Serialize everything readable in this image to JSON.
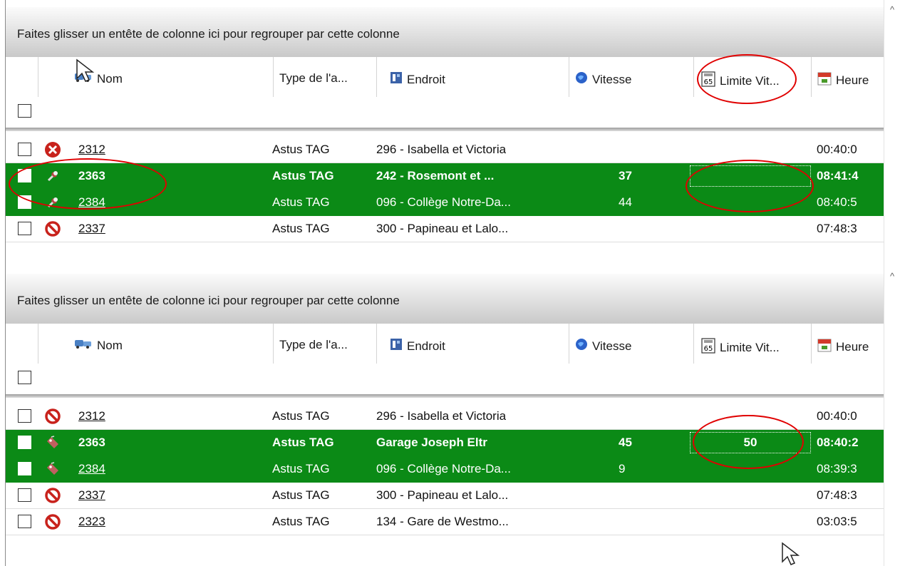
{
  "colors": {
    "selected_row_bg": "#0b8a16",
    "annotation": "#e00000"
  },
  "panels": [
    {
      "group_hint": "Faites glisser un entête de colonne ici pour regrouper par cette colonne",
      "columns": [
        {
          "label": "Nom",
          "icon": "bus-icon"
        },
        {
          "label": "Type de l'a...",
          "icon": ""
        },
        {
          "label": "Endroit",
          "icon": "building-icon"
        },
        {
          "label": "Vitesse",
          "icon": "globe-icon"
        },
        {
          "label": "Limite Vit...",
          "icon": "speed-limit-sign-icon"
        },
        {
          "label": "Heure",
          "icon": "calendar-icon"
        }
      ],
      "rows": [
        {
          "status_icon": "error-x-icon",
          "name": "2312",
          "type": "Astus TAG",
          "place": "296 - Isabella et Victoria",
          "speed": "",
          "limit": "",
          "time": "00:40:0"
        },
        {
          "status_icon": "pin-icon",
          "name": "2363",
          "type": "Astus TAG",
          "place": "242 - Rosemont et ...",
          "speed": "37",
          "limit": "",
          "time": "08:41:4"
        },
        {
          "status_icon": "pin-icon",
          "name": "2384",
          "type": "Astus TAG",
          "place": "096 - Collège Notre-Da...",
          "speed": "44",
          "limit": "",
          "time": "08:40:5"
        },
        {
          "status_icon": "no-entry-icon",
          "name": "2337",
          "type": "Astus TAG",
          "place": "300 - Papineau et Lalo...",
          "speed": "",
          "limit": "",
          "time": "07:48:3"
        }
      ]
    },
    {
      "group_hint": "Faites glisser un entête de colonne ici pour regrouper par cette colonne",
      "columns": [
        {
          "label": "Nom",
          "icon": "bus-icon"
        },
        {
          "label": "Type de l'a...",
          "icon": ""
        },
        {
          "label": "Endroit",
          "icon": "building-icon"
        },
        {
          "label": "Vitesse",
          "icon": "globe-icon"
        },
        {
          "label": "Limite Vit...",
          "icon": "speed-limit-sign-icon"
        },
        {
          "label": "Heure",
          "icon": "calendar-icon"
        }
      ],
      "rows": [
        {
          "status_icon": "no-entry-icon",
          "name": "2312",
          "type": "Astus TAG",
          "place": "296 - Isabella et Victoria",
          "speed": "",
          "limit": "",
          "time": "00:40:0"
        },
        {
          "status_icon": "tag-icon",
          "name": "2363",
          "type": "Astus TAG",
          "place": "Garage Joseph Eltr",
          "speed": "45",
          "limit": "50",
          "time": "08:40:2"
        },
        {
          "status_icon": "tag-icon",
          "name": "2384",
          "type": "Astus TAG",
          "place": "096 - Collège Notre-Da...",
          "speed": "9",
          "limit": "",
          "time": "08:39:3"
        },
        {
          "status_icon": "no-entry-icon",
          "name": "2337",
          "type": "Astus TAG",
          "place": "300 - Papineau et Lalo...",
          "speed": "",
          "limit": "",
          "time": "07:48:3"
        },
        {
          "status_icon": "no-entry-icon",
          "name": "2323",
          "type": "Astus TAG",
          "place": "134 - Gare de Westmo...",
          "speed": "",
          "limit": "",
          "time": "03:03:5"
        }
      ]
    }
  ]
}
